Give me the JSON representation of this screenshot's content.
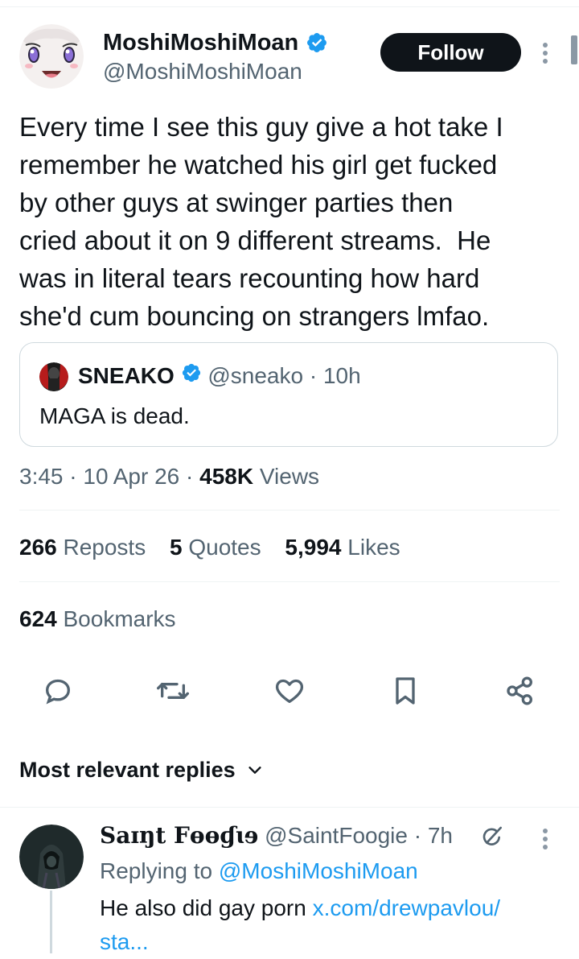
{
  "tweet": {
    "author": {
      "name": "MoshiMoshiMoan",
      "handle": "@MoshiMoshiMoan"
    },
    "follow_label": "Follow",
    "text": "Every time I see this guy give a hot take I\nremember he watched his girl get fucked\nby other guys at swinger parties then\ncried about it on 9 different streams.  He\nwas in literal tears recounting how hard\nshe'd cum bouncing on strangers lmfao.",
    "quote": {
      "name": "SNEAKO",
      "handle": "@sneako",
      "time": "· 10h",
      "text": "MAGA is dead."
    },
    "time": "3:45 · 10 Apr 26 · ",
    "views_count": "458K",
    "views_label": " Views",
    "stats": {
      "reposts_count": "266",
      "reposts_label": " Reposts",
      "quotes_count": "5",
      "quotes_label": " Quotes",
      "likes_count": "5,994",
      "likes_label": " Likes",
      "bookmarks_count": "624",
      "bookmarks_label": " Bookmarks"
    }
  },
  "replies": {
    "sort_label": "Most relevant replies",
    "items": [
      {
        "name": "Saɪŋt Fɵɵɠɩɘ",
        "handle": "@SaintFoogie",
        "time": "· 7h",
        "replying_prefix": "Replying to ",
        "replying_to": "@MoshiMoshiMoan",
        "text": "He also did gay porn ",
        "link": "x.com/drewpavlou/",
        "link_cont": "sta..."
      }
    ]
  },
  "colors": {
    "accent": "#1d9bf0",
    "text": "#0f1419",
    "muted": "#536471",
    "border": "#cfd9de"
  },
  "icons": [
    "verified-badge-icon",
    "more-options-icon",
    "reply-icon",
    "repost-icon",
    "like-icon",
    "bookmark-icon",
    "share-icon",
    "chevron-down-icon",
    "grok-icon"
  ]
}
